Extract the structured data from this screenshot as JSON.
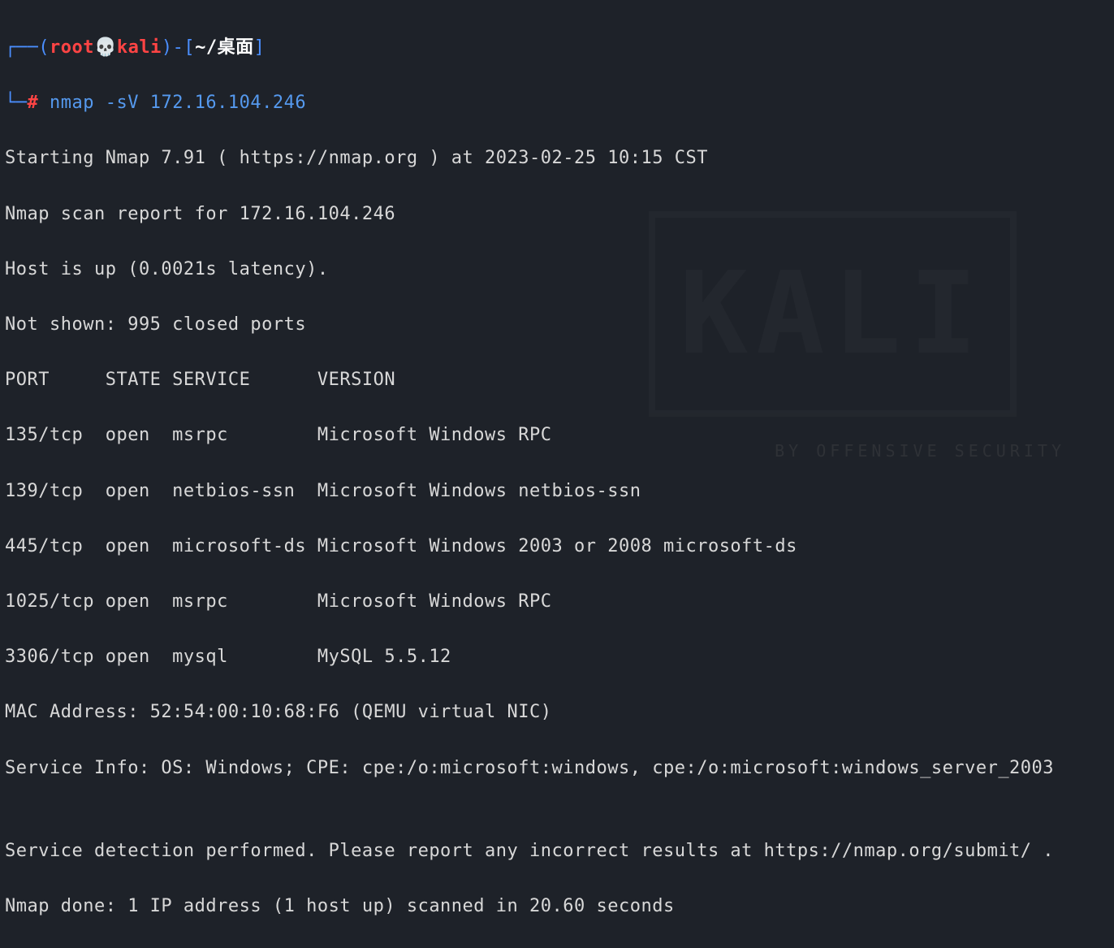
{
  "prompt": {
    "l_paren": "┌──(",
    "user": "root",
    "skull": "💀",
    "host": "kali",
    "r_paren": ")-[",
    "path": "~/桌面",
    "close": "]",
    "line2_prefix": "└─",
    "hash": "#",
    "command": "nmap -sV 172.16.104.246"
  },
  "output": {
    "starting": "Starting Nmap 7.91 ( https://nmap.org ) at 2023-02-25 10:15 CST",
    "report": "Nmap scan report for 172.16.104.246",
    "host_up": "Host is up (0.0021s latency).",
    "not_shown": "Not shown: 995 closed ports",
    "header": "PORT     STATE SERVICE      VERSION",
    "rows": [
      "135/tcp  open  msrpc        Microsoft Windows RPC",
      "139/tcp  open  netbios-ssn  Microsoft Windows netbios-ssn",
      "445/tcp  open  microsoft-ds Microsoft Windows 2003 or 2008 microsoft-ds",
      "1025/tcp open  msrpc        Microsoft Windows RPC",
      "3306/tcp open  mysql        MySQL 5.5.12"
    ],
    "mac": "MAC Address: 52:54:00:10:68:F6 (QEMU virtual NIC)",
    "service_info": "Service Info: OS: Windows; CPE: cpe:/o:microsoft:windows, cpe:/o:microsoft:windows_server_2003",
    "blank": "",
    "detection": "Service detection performed. Please report any incorrect results at https://nmap.org/submit/ .",
    "done": "Nmap done: 1 IP address (1 host up) scanned in 20.60 seconds"
  },
  "watermark": {
    "logo": "KALI",
    "sub": "BY OFFENSIVE SECURITY"
  }
}
